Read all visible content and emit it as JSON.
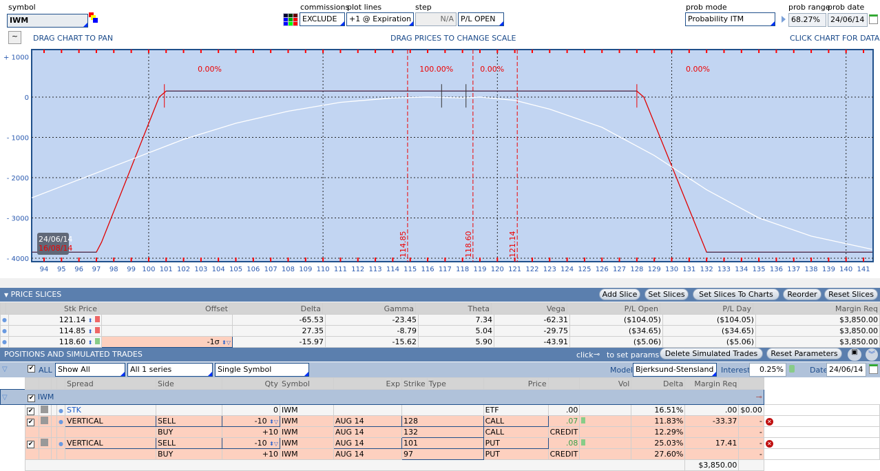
{
  "toolbar": {
    "symbol_label": "symbol",
    "symbol": "IWM",
    "commissions_label": "commissions",
    "commissions": "EXCLUDE",
    "plot_lines_label": "plot lines",
    "plot_lines": "+1 @ Expiration",
    "step_label": "step",
    "step": "N/A",
    "pl_mode": "P/L OPEN",
    "prob_mode_label": "prob mode",
    "prob_mode": "Probability ITM",
    "prob_range_label": "prob range",
    "prob_range": "68.27%",
    "prob_date_label": "prob date",
    "prob_date": "24/06/14"
  },
  "hints": {
    "pan": "DRAG CHART TO PAN",
    "scale": "DRAG PRICES TO CHANGE SCALE",
    "data": "CLICK CHART FOR DATA"
  },
  "chart_data": {
    "type": "line",
    "xlim": [
      93.3,
      141.5
    ],
    "ylim": [
      -4150,
      1000
    ],
    "x_ticks": [
      "94",
      "95",
      "96",
      "97",
      "98",
      "99",
      "100",
      "101",
      "102",
      "103",
      "104",
      "105",
      "106",
      "107",
      "108",
      "109",
      "110",
      "111",
      "112",
      "113",
      "114",
      "115",
      "116",
      "117",
      "118",
      "119",
      "120",
      "121",
      "122",
      "123",
      "124",
      "125",
      "126",
      "127",
      "128",
      "129",
      "130",
      "131",
      "132",
      "133",
      "134",
      "135",
      "136",
      "137",
      "138",
      "139",
      "140",
      "141"
    ],
    "y_ticks": [
      {
        "v": 1000,
        "label": "+ 1000"
      },
      {
        "v": 0,
        "label": "0"
      },
      {
        "v": -1000,
        "label": "- 1000"
      },
      {
        "v": -2000,
        "label": "- 2000"
      },
      {
        "v": -3000,
        "label": "- 3000"
      },
      {
        "v": -4000,
        "label": "- 4000"
      }
    ],
    "series": [
      {
        "name": "16/08/14",
        "color": "#e00000",
        "x": [
          93.3,
          97,
          97.3,
          100.6,
          101,
          128,
          128.4,
          132,
          141.5
        ],
        "y": [
          -3850,
          -3850,
          -3600,
          0,
          150,
          150,
          0,
          -3850,
          -3850
        ]
      },
      {
        "name": "24/06/14",
        "color": "#ffffff",
        "x": [
          93.3,
          96,
          99,
          102,
          105,
          108,
          111,
          114,
          116,
          118,
          119,
          121,
          123,
          126,
          129,
          132,
          135,
          138,
          141.5
        ],
        "y": [
          -2500,
          -2050,
          -1550,
          -1050,
          -650,
          -350,
          -130,
          -20,
          0,
          -20,
          0,
          -80,
          -300,
          -750,
          -1450,
          -2300,
          -3000,
          -3450,
          -3780
        ]
      }
    ],
    "slices": [
      {
        "v": 114.85,
        "label": "114.85"
      },
      {
        "v": 118.6,
        "label": "118.60"
      },
      {
        "v": 121.14,
        "label": "121.14"
      }
    ],
    "probs": [
      {
        "x": 103.5,
        "label": "0.00%"
      },
      {
        "x": 116.5,
        "label": "100.00%"
      },
      {
        "x": 119.7,
        "label": "0.00%"
      },
      {
        "x": 131.5,
        "label": "0.00%"
      }
    ],
    "legend": [
      "24/06/14",
      "16/08/14"
    ]
  },
  "slices": {
    "title": "PRICE SLICES",
    "buttons": [
      "Add Slice",
      "Set Slices",
      "Set Slices To Charts",
      "Reorder",
      "Reset Slices"
    ],
    "headers": [
      "Stk Price",
      "Offset",
      "Delta",
      "Gamma",
      "Theta",
      "Vega",
      "P/L Open",
      "P/L Day",
      "Margin Req"
    ],
    "rows": [
      [
        "121.14",
        "",
        "-65.53",
        "-23.45",
        "7.34",
        "-62.31",
        "($104.05)",
        "($104.05)",
        "$3,850.00"
      ],
      [
        "114.85",
        "",
        "27.35",
        "-8.79",
        "5.04",
        "-29.75",
        "($34.65)",
        "($34.65)",
        "$3,850.00"
      ],
      [
        "118.60",
        "-1σ",
        "-15.97",
        "-15.62",
        "5.90",
        "-43.91",
        "($5.06)",
        "($5.06)",
        "$3,850.00"
      ]
    ]
  },
  "positions": {
    "title": "POSITIONS AND SIMULATED TRADES",
    "click": "click",
    "set_params": "to set params",
    "delete_btn": "Delete Simulated Trades",
    "reset_btn": "Reset Parameters",
    "all": "ALL",
    "show": "Show All",
    "series": "All 1 series",
    "symbol_mode": "Single Symbol",
    "model_label": "Model",
    "model": "Bjerksund-Stensland",
    "interest_label": "Interest",
    "interest": "0.25%",
    "date_label": "Date",
    "date": "24/06/14",
    "headers": [
      "Spread",
      "Side",
      "Qty",
      "Symbol",
      "Exp",
      "Strike",
      "Type",
      "Price",
      "Vol",
      "Delta",
      "Margin Req"
    ],
    "group": "IWM",
    "rows": [
      {
        "spread": "STK",
        "side": "",
        "qty": "0",
        "sym": "IWM",
        "exp": "",
        "strike": "",
        "type": "ETF",
        "price": ".00",
        "vol": "16.51%",
        "delta": ".00",
        "margin": "$0.00"
      },
      {
        "spread": "VERTICAL",
        "side": "SELL",
        "qty": "-10",
        "sym": "IWM",
        "exp": "AUG 14",
        "strike": "128",
        "type": "CALL",
        "price": ".07",
        "vol": "11.83%",
        "delta": "-33.37",
        "margin": "-"
      },
      {
        "spread": "",
        "side": "BUY",
        "qty": "+10",
        "sym": "IWM",
        "exp": "AUG 14",
        "strike": "132",
        "type": "CALL",
        "price": "CREDIT",
        "vol": "12.29%",
        "delta": "",
        "margin": "-"
      },
      {
        "spread": "VERTICAL",
        "side": "SELL",
        "qty": "-10",
        "sym": "IWM",
        "exp": "AUG 14",
        "strike": "101",
        "type": "PUT",
        "price": ".08",
        "vol": "25.03%",
        "delta": "17.41",
        "margin": "-"
      },
      {
        "spread": "",
        "side": "BUY",
        "qty": "+10",
        "sym": "IWM",
        "exp": "AUG 14",
        "strike": "97",
        "type": "PUT",
        "price": "CREDIT",
        "vol": "27.60%",
        "delta": "",
        "margin": "-"
      }
    ],
    "total_margin": "$3,850.00"
  }
}
